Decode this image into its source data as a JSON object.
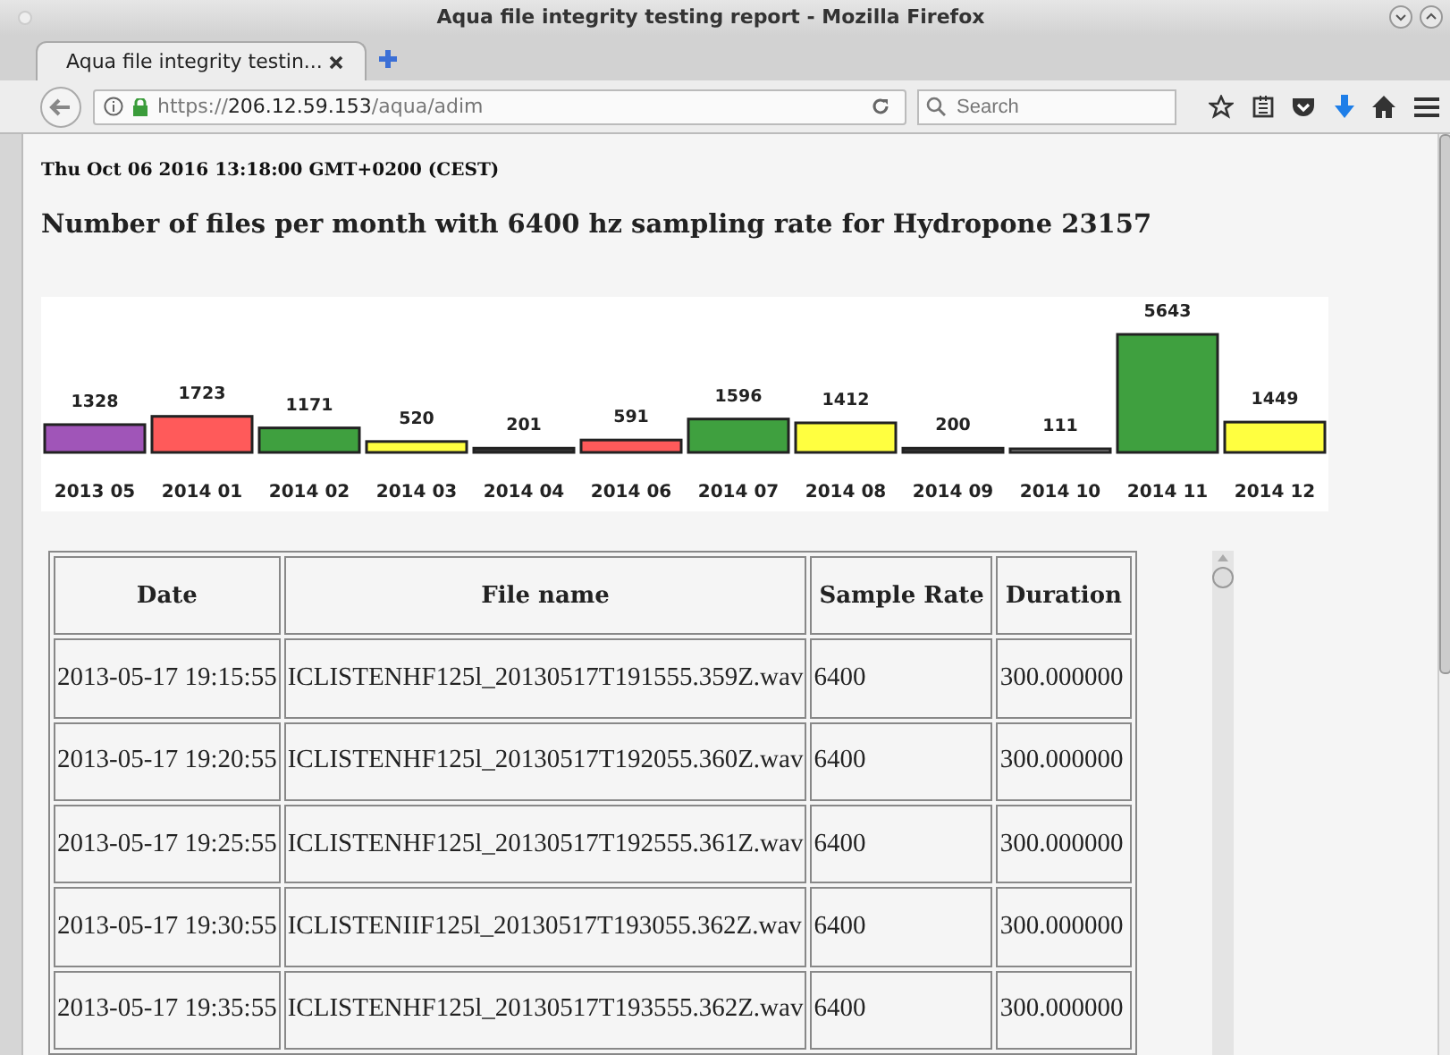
{
  "window": {
    "title": "Aqua file integrity testing report - Mozilla Firefox"
  },
  "tabs": [
    {
      "label": "Aqua file integrity testin...",
      "selected": true
    }
  ],
  "address_bar": {
    "scheme": "https://",
    "host": "206.12.59.153",
    "path": "/aqua/adim"
  },
  "search": {
    "placeholder": "Search"
  },
  "page": {
    "timestamp": "Thu Oct 06 2016 13:18:00 GMT+0200 (CEST)",
    "heading": "Number of files per month with 6400 hz sampling rate for Hydropone 23157",
    "chart_data": {
      "type": "bar",
      "data_labels": true,
      "categories": [
        "2013 05",
        "2014 01",
        "2014 02",
        "2014 03",
        "2014 04",
        "2014 06",
        "2014 07",
        "2014 08",
        "2014 09",
        "2014 10",
        "2014 11",
        "2014 12"
      ],
      "series": [
        {
          "color": "#a055b8",
          "values": [
            1328,
            null,
            null,
            null,
            null,
            null,
            null,
            null,
            null,
            null,
            null,
            null
          ]
        },
        {
          "color": "#ff5a5a",
          "values": [
            null,
            1723,
            null,
            null,
            null,
            591,
            null,
            null,
            null,
            null,
            null,
            null
          ]
        },
        {
          "color": "#3fa03f",
          "values": [
            null,
            null,
            1171,
            null,
            null,
            null,
            1596,
            null,
            null,
            null,
            5643,
            null
          ]
        },
        {
          "color": "#ffff40",
          "values": [
            null,
            null,
            null,
            520,
            null,
            null,
            null,
            1412,
            null,
            null,
            null,
            1449
          ]
        },
        {
          "color": "#333333",
          "values": [
            null,
            null,
            null,
            null,
            201,
            null,
            null,
            null,
            200,
            null,
            null,
            null
          ]
        },
        {
          "color": "#999999",
          "values": [
            null,
            null,
            null,
            null,
            null,
            null,
            null,
            null,
            null,
            111,
            null,
            null
          ]
        }
      ]
    },
    "table": {
      "columns": [
        "Date",
        "File name",
        "Sample Rate",
        "Duration"
      ],
      "rows": [
        [
          "2013-05-17 19:15:55",
          "ICLISTENHF125l_20130517T191555.359Z.wav",
          "6400",
          "300.000000"
        ],
        [
          "2013-05-17 19:20:55",
          "ICLISTENHF125l_20130517T192055.360Z.wav",
          "6400",
          "300.000000"
        ],
        [
          "2013-05-17 19:25:55",
          "ICLISTENHF125l_20130517T192555.361Z.wav",
          "6400",
          "300.000000"
        ],
        [
          "2013-05-17 19:30:55",
          "ICLISTENIIF125l_20130517T193055.362Z.wav",
          "6400",
          "300.000000"
        ],
        [
          "2013-05-17 19:35:55",
          "ICLISTENHF125l_20130517T193555.362Z.wav",
          "6400",
          "300.000000"
        ]
      ]
    }
  }
}
